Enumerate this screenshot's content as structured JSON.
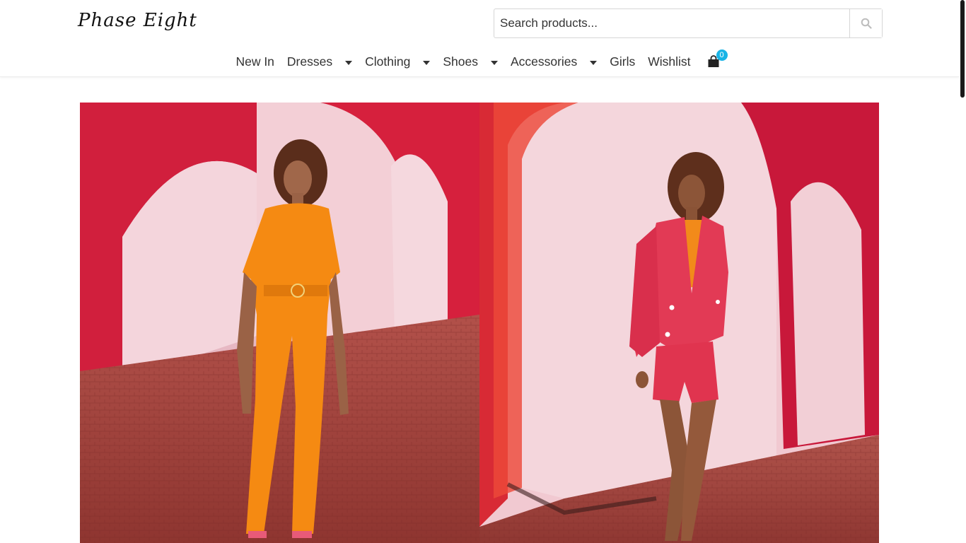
{
  "brand": {
    "name": "Phase Eight"
  },
  "search": {
    "placeholder": "Search products..."
  },
  "nav": {
    "items": [
      {
        "label": "New In",
        "dropdown": false
      },
      {
        "label": "Dresses",
        "dropdown": true
      },
      {
        "label": "Clothing",
        "dropdown": true
      },
      {
        "label": "Shoes",
        "dropdown": true
      },
      {
        "label": "Accessories",
        "dropdown": true
      },
      {
        "label": "Girls",
        "dropdown": false
      },
      {
        "label": "Wishlist",
        "dropdown": false
      }
    ],
    "cart": {
      "icon": "shopping-bag-icon",
      "count": "0"
    }
  },
  "hero": {
    "panels": [
      {
        "subject": "model-orange-jumpsuit",
        "garment_color": "#f58a12"
      },
      {
        "subject": "model-pink-suit",
        "garment_color": "#e23a55"
      }
    ]
  },
  "colors": {
    "accent": "#19b4e6",
    "arch_red": "#d8213a",
    "wall_pink": "#f1c6cf",
    "floor": "#a04038"
  }
}
